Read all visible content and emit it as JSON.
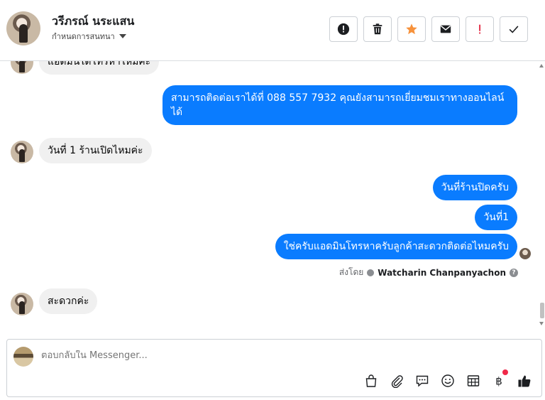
{
  "header": {
    "contact_name": "วรีภรณ์ นระแสน",
    "subtitle": "กำหนดการสนทนา"
  },
  "actions": [
    {
      "name": "spam-button",
      "icon": "alert-circle-icon"
    },
    {
      "name": "delete-button",
      "icon": "trash-icon"
    },
    {
      "name": "star-button",
      "icon": "star-icon",
      "color": "#f7923b"
    },
    {
      "name": "mark-unread-button",
      "icon": "envelope-icon"
    },
    {
      "name": "important-button",
      "icon": "exclamation-icon",
      "color": "#e4314a"
    },
    {
      "name": "done-button",
      "icon": "check-icon"
    }
  ],
  "messages": {
    "m0_partial": "แอดมินได้โทรหาไหมคะ",
    "m1": "สามารถติดต่อเราได้ที่ 088 557 7932 คุณยังสามารถเยี่ยมชมเราทางออนไลน์ได้",
    "m2": "วันที่ 1 ร้านเปิดไหมค่ะ",
    "m3": "วันที่ร้านปิดครับ",
    "m4": "วันที่1",
    "m5": "ใช่ครับแอดมินโทรหาครับลูกค้าสะดวกติดต่อไหมครับ",
    "m6": "สะดวกค่ะ"
  },
  "sent_by": {
    "label": "ส่งโดย",
    "name": "Watcharin Chanpanyachon"
  },
  "composer": {
    "placeholder": "ตอบกลับใน Messenger..."
  },
  "colors": {
    "outgoing": "#0a7cff",
    "incoming": "#f0f0f0",
    "like": "#1c1e21"
  }
}
